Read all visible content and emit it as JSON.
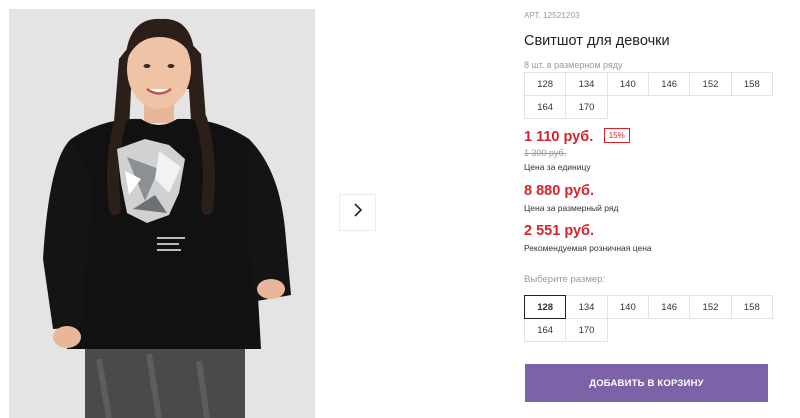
{
  "product": {
    "sku_label": "АРТ.",
    "sku": "12521203",
    "title": "Свитшот для девочки",
    "row_note": "8 шт. в размерном ряду",
    "row_sizes": [
      "128",
      "134",
      "140",
      "146",
      "152",
      "158",
      "164",
      "170"
    ]
  },
  "prices": {
    "unit_price": "1 110 руб.",
    "discount": "15%",
    "old_price": "1 300 руб.",
    "unit_caption": "Цена за единицу",
    "row_price": "8 880 руб.",
    "row_caption": "Цена за размерный ряд",
    "retail_price": "2 551 руб.",
    "retail_caption": "Рекомендуемая розничная цена"
  },
  "size_picker": {
    "label": "Выберите размер:",
    "sizes": [
      "128",
      "134",
      "140",
      "146",
      "152",
      "158",
      "164",
      "170"
    ],
    "selected": "128"
  },
  "actions": {
    "add_to_cart": "ДОБАВИТЬ В КОРЗИНУ"
  },
  "icons": {
    "next": "chevron-right-icon"
  }
}
